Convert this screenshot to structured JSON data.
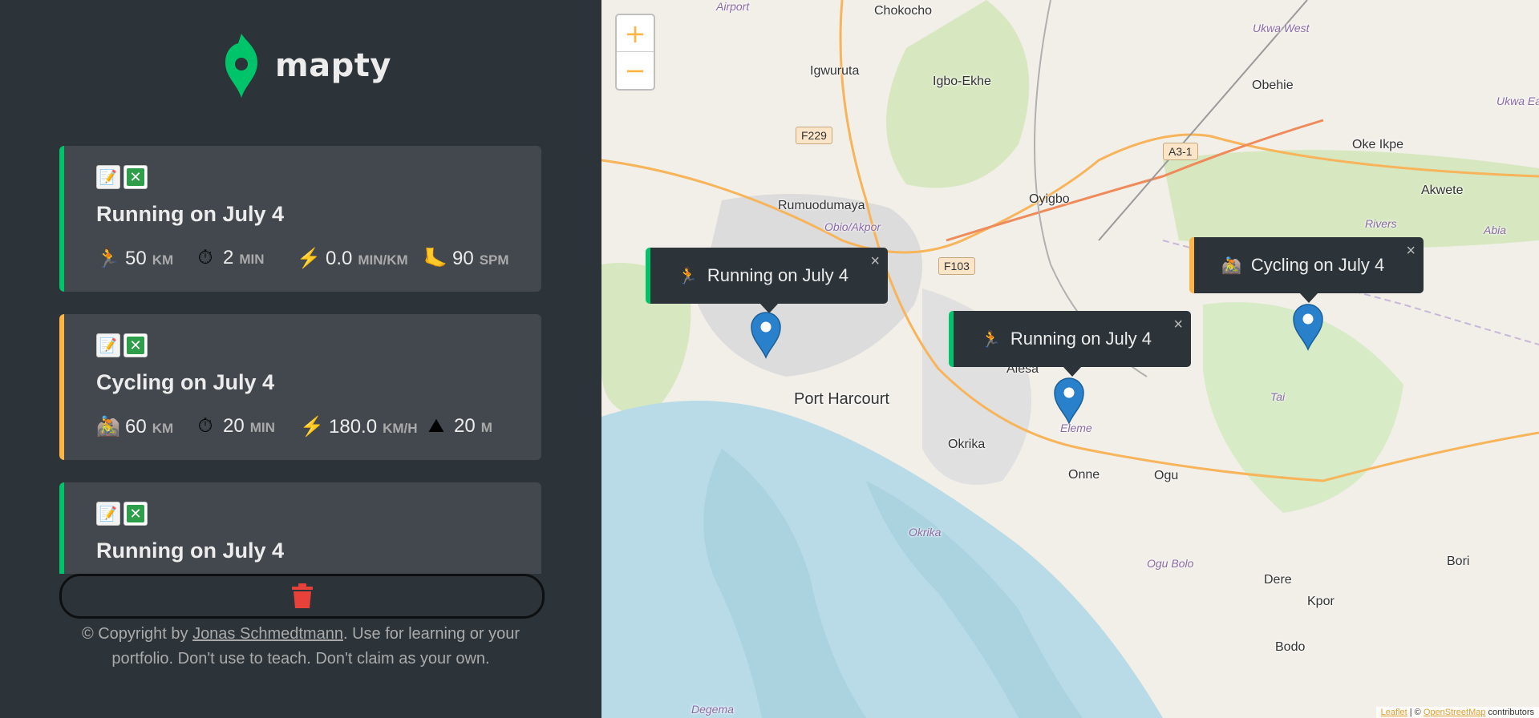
{
  "app": {
    "name": "mapty"
  },
  "workouts": [
    {
      "type": "running",
      "title": "Running on July 4",
      "details": [
        {
          "icon": "running-icon",
          "glyph": "🏃",
          "value": "50",
          "unit": "km"
        },
        {
          "icon": "stopwatch-icon",
          "glyph": "⏱",
          "value": "2",
          "unit": "min"
        },
        {
          "icon": "lightning-icon",
          "glyph": "⚡",
          "value": "0.0",
          "unit": "min/km"
        },
        {
          "icon": "footprint-icon",
          "glyph": "🦶",
          "value": "90",
          "unit": "spm"
        }
      ]
    },
    {
      "type": "cycling",
      "title": "Cycling on July 4",
      "details": [
        {
          "icon": "cycling-icon",
          "glyph": "🚵",
          "value": "60",
          "unit": "km"
        },
        {
          "icon": "stopwatch-icon",
          "glyph": "⏱",
          "value": "20",
          "unit": "min"
        },
        {
          "icon": "lightning-icon",
          "glyph": "⚡",
          "value": "180.0",
          "unit": "km/h"
        },
        {
          "icon": "mountain-icon",
          "glyph": "⛰",
          "value": "20",
          "unit": "m"
        }
      ]
    },
    {
      "type": "running",
      "title": "Running on July 4",
      "details": []
    }
  ],
  "footer": {
    "prefix": "© Copyright by ",
    "author": "Jonas Schmedtmann",
    "suffix": ". Use for learning or your portfolio. Don't use to teach. Don't claim as your own."
  },
  "map": {
    "zoom_in": "+",
    "zoom_out": "−",
    "places": {
      "airport": "Airport",
      "chokocho": "Chokocho",
      "igwuruta": "Igwuruta",
      "igbo_ekhe": "Igbo-Ekhe",
      "obehie": "Obehie",
      "oke_ikpe": "Oke Ikpe",
      "akwete": "Akwete",
      "rumuodumaya": "Rumuodumaya",
      "obio_akpor": "Obio/Akpor",
      "oyigbo": "Oyigbo",
      "port_harcourt": "Port Harcourt",
      "okrika": "Okrika",
      "onne": "Onne",
      "ogu": "Ogu",
      "eleme": "Eleme",
      "alesa": "Alesa",
      "tai": "Tai",
      "rivers": "Rivers",
      "abia": "Abia",
      "ukwa_west": "Ukwa West",
      "ukwa_east": "Ukwa Ea",
      "okrika_lga": "Okrika",
      "ogu_bolo": "Ogu Bolo",
      "bori": "Bori",
      "dere": "Dere",
      "kpor": "Kpor",
      "bodo": "Bodo",
      "degema": "Degema"
    },
    "roads": {
      "f229": "F229",
      "f103": "F103",
      "a3_1": "A3-1"
    },
    "popups": [
      {
        "type": "running",
        "glyph": "🏃",
        "text": "Running on July 4"
      },
      {
        "type": "running",
        "glyph": "🏃",
        "text": "Running on July 4"
      },
      {
        "type": "cycling",
        "glyph": "🚵",
        "text": "Cycling on July 4"
      }
    ],
    "close_glyph": "×",
    "attribution": {
      "leaflet": "Leaflet",
      "sep": " | © ",
      "osm": "OpenStreetMap",
      "tail": " contributors"
    }
  },
  "colors": {
    "running": "#00c46a",
    "cycling": "#ffb545",
    "sidebar": "#2d3439",
    "card": "#42484d"
  }
}
